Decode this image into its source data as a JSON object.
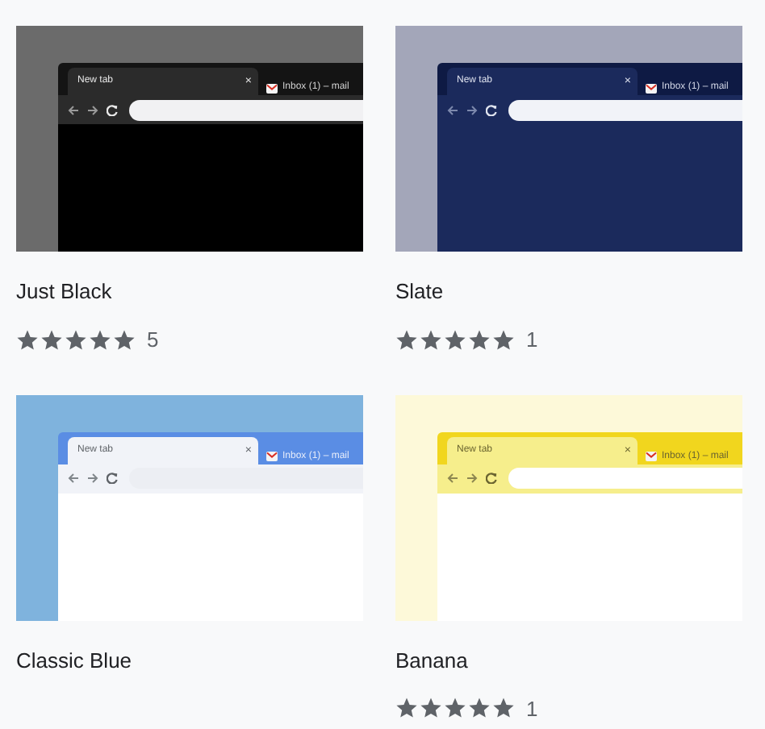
{
  "themes": [
    {
      "name": "Just Black",
      "kind": "dark",
      "preview": {
        "active_tab": "New tab",
        "close": "×",
        "other_tab": "Inbox (1) – mail"
      },
      "stars": 5,
      "rating_count": "5"
    },
    {
      "name": "Slate",
      "kind": "slate",
      "preview": {
        "active_tab": "New tab",
        "close": "×",
        "other_tab": "Inbox (1) – mail"
      },
      "stars": 5,
      "rating_count": "1"
    },
    {
      "name": "Classic Blue",
      "kind": "blue",
      "preview": {
        "active_tab": "New tab",
        "close": "×",
        "other_tab": "Inbox (1) – mail"
      }
    },
    {
      "name": "Banana",
      "kind": "banana",
      "preview": {
        "active_tab": "New tab",
        "close": "×",
        "other_tab": "Inbox (1) – mail"
      },
      "stars": 5,
      "rating_count": "1"
    }
  ]
}
